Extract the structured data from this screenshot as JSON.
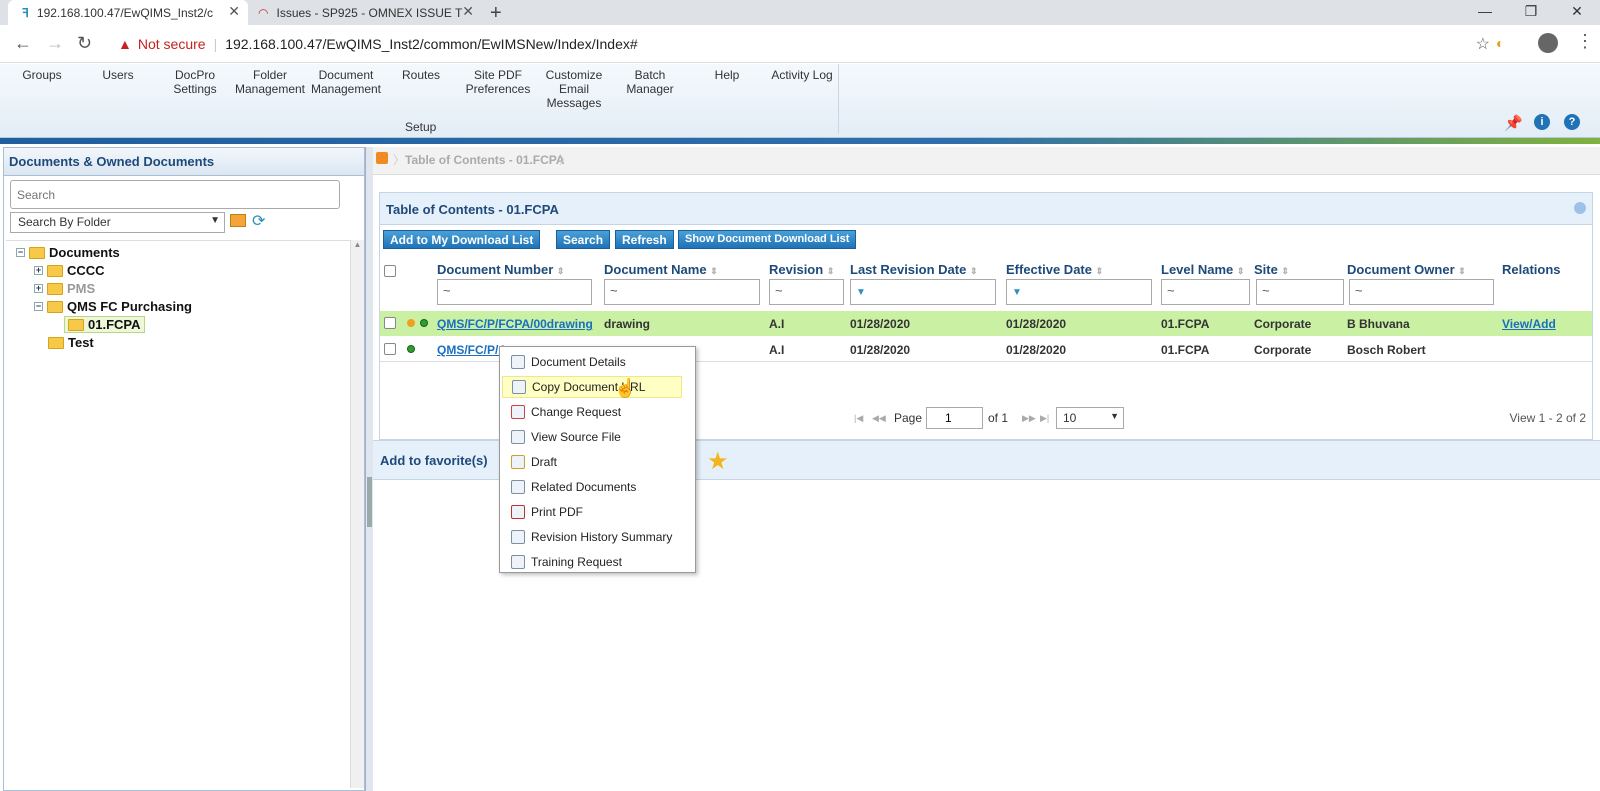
{
  "browser": {
    "tabs": [
      {
        "title": "192.168.100.47/EwQIMS_Inst2/c",
        "active": true
      },
      {
        "title": "Issues - SP925 - OMNEX ISSUE T",
        "active": false
      }
    ],
    "security_label": "Not secure",
    "url": "192.168.100.47/EwQIMS_Inst2/common/EwIMSNew/Index/Index#"
  },
  "ribbon": {
    "items": [
      {
        "label": "Groups"
      },
      {
        "label": "Users"
      },
      {
        "label": "DocPro\nSettings"
      },
      {
        "label": "Folder\nManagement"
      },
      {
        "label": "Document\nManagement"
      },
      {
        "label": "Routes"
      },
      {
        "label": "Site PDF\nPreferences"
      },
      {
        "label": "Customize\nEmail\nMessages"
      },
      {
        "label": "Batch\nManager"
      },
      {
        "label": "Help"
      },
      {
        "label": "Activity Log"
      }
    ],
    "group_label": "Setup"
  },
  "left_panel": {
    "title": "Documents & Owned Documents",
    "search_placeholder": "Search",
    "search_by": "Search By Folder",
    "tree": {
      "root": "Documents",
      "children": [
        "CCCC",
        "PMS",
        "QMS FC Purchasing",
        "01.FCPA",
        "Test"
      ]
    }
  },
  "breadcrumb": {
    "label": "Table of Contents - 01.FCPA"
  },
  "grid": {
    "title": "Table of Contents - 01.FCPA",
    "buttons": {
      "add_download": "Add to My Download List",
      "search": "Search",
      "refresh": "Refresh",
      "show_download": "Show Document Download List"
    },
    "columns": [
      "Document Number",
      "Document Name",
      "Revision",
      "Last Revision Date",
      "Effective Date",
      "Level Name",
      "Site",
      "Document Owner",
      "Relations"
    ],
    "filter_symbol": "~",
    "rows": [
      {
        "doc_number": "QMS/FC/P/FCPA/00drawing",
        "doc_name": "drawing",
        "revision": "A.I",
        "last_rev": "01/28/2020",
        "effective": "01/28/2020",
        "level": "01.FCPA",
        "site": "Corporate",
        "owner": "B Bhuvana",
        "relations": "View/Add"
      },
      {
        "doc_number": "QMS/FC/P/A",
        "doc_name": "",
        "revision": "A.I",
        "last_rev": "01/28/2020",
        "effective": "01/28/2020",
        "level": "01.FCPA",
        "site": "Corporate",
        "owner": "Bosch Robert",
        "relations": ""
      }
    ],
    "pager": {
      "page_label": "Page",
      "page": "1",
      "of_label": "of 1",
      "page_size": "10",
      "summary": "View 1 - 2 of 2"
    }
  },
  "favorites": {
    "label": "Add to favorite(s)"
  },
  "context_menu": {
    "items": [
      {
        "label": "Document Details"
      },
      {
        "label": "Copy Document URL"
      },
      {
        "label": "Change Request"
      },
      {
        "label": "View Source File"
      },
      {
        "label": "Draft"
      },
      {
        "label": "Related Documents"
      },
      {
        "label": "Print PDF"
      },
      {
        "label": "Revision History Summary"
      },
      {
        "label": "Training Request"
      }
    ]
  },
  "colors": {
    "accent": "#1f73b6",
    "header_text": "#1d4a7a",
    "row_highlight": "#c9f0a3",
    "menu_highlight": "#ffffc4"
  }
}
